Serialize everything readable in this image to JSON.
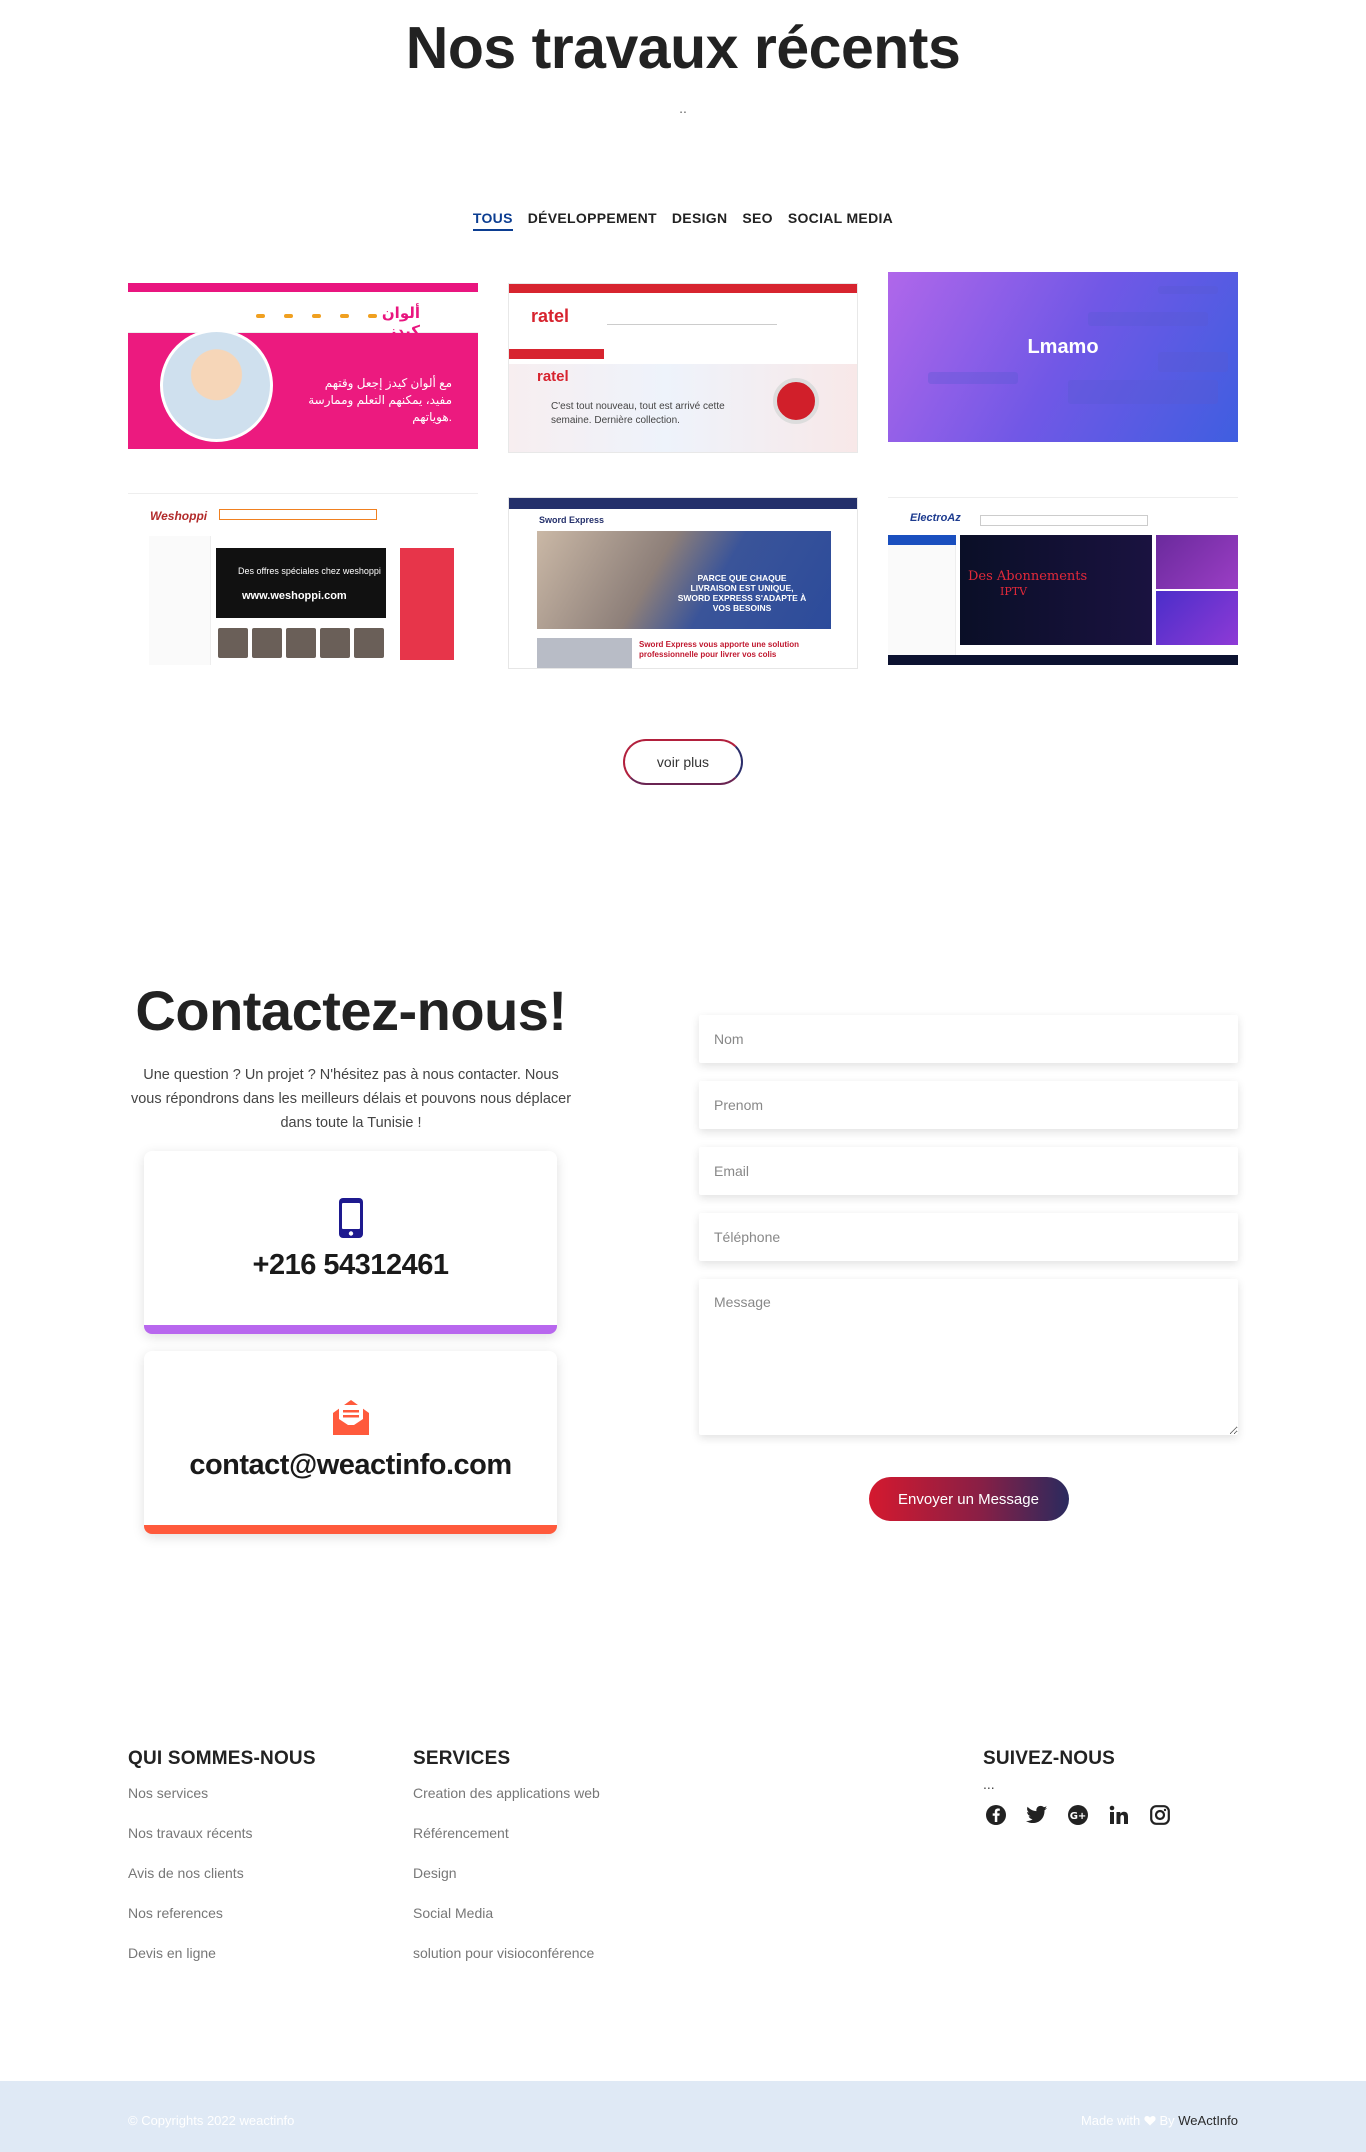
{
  "portfolio": {
    "title": "Nos travaux récents",
    "dots": "..",
    "filters": [
      "TOUS",
      "DÉVELOPPEMENT",
      "DESIGN",
      "SEO",
      "SOCIAL MEDIA"
    ],
    "active_filter": "TOUS",
    "projects": [
      {
        "name": "Alwen Kids",
        "arabic_text": "مع ألوان كيدز إجعل وقتهم مفيد، يمكنهم التعلم وممارسة هوياتهم."
      },
      {
        "name": "ratel",
        "hero_text": "C'est tout nouveau, tout est arrivé cette semaine. Dernière collection."
      },
      {
        "name": "Lmamo"
      },
      {
        "name": "Weshoppi",
        "banner_line1": "Des offres spéciales chez weshoppi",
        "banner_line2": "www.weshoppi.com"
      },
      {
        "name": "Sword Express",
        "hero_text": "PARCE QUE CHAQUE LIVRAISON EST UNIQUE, SWORD EXPRESS S'ADAPTE À VOS BESOINS",
        "sub_text": "Sword Express vous apporte une solution professionnelle pour livrer vos colis"
      },
      {
        "name": "ElectroAz",
        "banner_line1": "Des Abonnements",
        "banner_line2": "IPTV"
      }
    ],
    "more_label": "voir plus"
  },
  "contact": {
    "title": "Contactez-nous!",
    "description": "Une question ? Un projet ? N'hésitez pas à nous contacter. Nous vous répondrons dans les meilleurs délais et pouvons nous déplacer dans toute la Tunisie !",
    "phone": "+216 54312461",
    "email": "contact@weactinfo.com",
    "form": {
      "nom_placeholder": "Nom",
      "prenom_placeholder": "Prenom",
      "email_placeholder": "Email",
      "telephone_placeholder": "Téléphone",
      "message_placeholder": "Message",
      "submit_label": "Envoyer un Message"
    },
    "accent_colors": {
      "phone_bar": "#b867ee",
      "mail_bar": "#ff5a3c",
      "phone_icon": "#1e1a8f",
      "mail_icon": "#ff5a3c"
    }
  },
  "footer": {
    "about": {
      "heading": "QUI SOMMES-NOUS",
      "links": [
        "Nos services",
        "Nos travaux récents",
        "Avis de nos clients",
        "Nos references",
        "Devis en ligne"
      ]
    },
    "services": {
      "heading": "SERVICES",
      "links": [
        "Creation des applications web",
        "Référencement",
        "Design",
        "Social Media",
        "solution pour visioconférence"
      ]
    },
    "follow": {
      "heading": "SUIVEZ-NOUS",
      "dots": "...",
      "icons": [
        "facebook-icon",
        "twitter-icon",
        "google-plus-icon",
        "linkedin-icon",
        "instagram-icon"
      ]
    },
    "copyright": "© Copyrights 2022 weactinfo",
    "made_with": "Made with",
    "by": "By",
    "brand": "WeActInfo"
  }
}
